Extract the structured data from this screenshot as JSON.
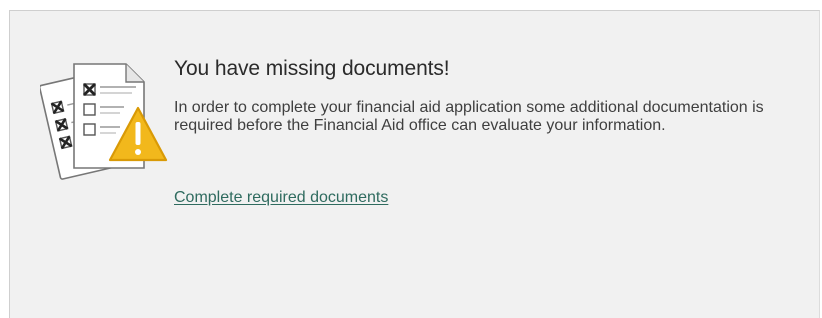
{
  "notice": {
    "title": "You have missing documents!",
    "message": "In order to complete your financial aid application some additional documentation is required before the Financial Aid office can evaluate your information.",
    "link_label": "Complete required documents",
    "icon": "missing-documents-warning-icon",
    "link_color": "#2f6b5f",
    "warning_color": "#f2b81c"
  }
}
